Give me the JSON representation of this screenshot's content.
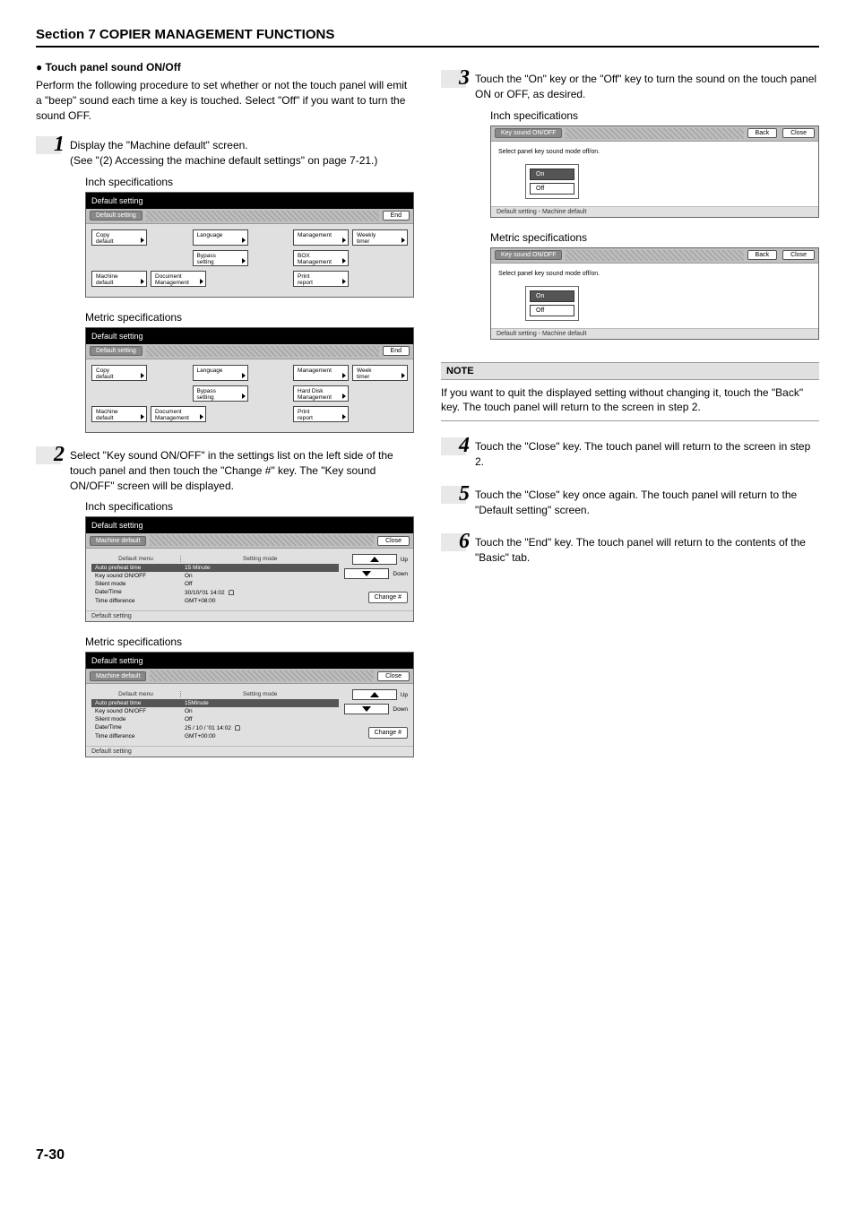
{
  "header": "Section 7  COPIER MANAGEMENT FUNCTIONS",
  "subsection_title": "Touch panel sound ON/Off",
  "intro": "Perform the following procedure to set whether or not the touch panel will emit a \"beep\" sound each time a key is touched. Select \"Off\" if you want to turn the sound OFF.",
  "step1": {
    "num": "1",
    "text": "Display the \"Machine default\" screen.\n(See \"(2) Accessing the machine default settings\" on page 7-21.)"
  },
  "inch_label": "Inch specifications",
  "metric_label": "Metric specifications",
  "panel_ds_inch": {
    "title": "Default setting",
    "crumb": "Default setting",
    "end": "End",
    "tiles_r1": [
      "Copy\ndefault",
      "Language",
      "Management",
      "Weekly\ntimer"
    ],
    "tiles_r1b": [
      "Bypass\nsetting",
      "BOX\nManagement"
    ],
    "tiles_r2": [
      "Machine\ndefault",
      "Document\nManagement",
      "Print\nreport"
    ]
  },
  "panel_ds_metric": {
    "title": "Default setting",
    "crumb": "Default setting",
    "end": "End",
    "tiles_r1": [
      "Copy\ndefault",
      "Language",
      "Management",
      "Week\ntimer"
    ],
    "tiles_r1b": [
      "Bypass\nsetting",
      "Hard Disk\nManagement"
    ],
    "tiles_r2": [
      "Machine\ndefault",
      "Document\nManagement",
      "Print\nreport"
    ]
  },
  "step2": {
    "num": "2",
    "text": "Select \"Key sound ON/OFF\" in the settings list on the left side of the touch panel and then touch the \"Change #\" key. The \"Key sound ON/OFF\" screen will be displayed."
  },
  "panel_md_inch": {
    "title": "Default setting",
    "crumb": "Machine default",
    "close": "Close",
    "head_left": "Default menu",
    "head_right": "Setting mode",
    "rows": [
      {
        "l": "Auto preheat time",
        "r": "15 Minute",
        "sel": true
      },
      {
        "l": "Key sound ON/OFF",
        "r": "On"
      },
      {
        "l": "Silent mode",
        "r": "Off"
      },
      {
        "l": "Date/Time",
        "r": "30/10/'01 14:02"
      },
      {
        "l": "Time difference",
        "r": "GMT+08:00"
      }
    ],
    "up": "Up",
    "down": "Down",
    "change": "Change #",
    "foot": "Default setting"
  },
  "panel_md_metric": {
    "title": "Default setting",
    "crumb": "Machine default",
    "close": "Close",
    "head_left": "Default menu",
    "head_right": "Setting mode",
    "rows": [
      {
        "l": "Auto preheat time",
        "r": "15Minute",
        "sel": true
      },
      {
        "l": "Key sound ON/OFF",
        "r": "On"
      },
      {
        "l": "Silent mode",
        "r": "Off"
      },
      {
        "l": "Date/Time",
        "r": "25 / 10 / '01 14:02"
      },
      {
        "l": "Time difference",
        "r": "GMT+00:00"
      }
    ],
    "up": "Up",
    "down": "Down",
    "change": "Change #",
    "foot": "Default setting"
  },
  "step3": {
    "num": "3",
    "text": "Touch the \"On\" key or the \"Off\" key to turn the sound on the touch panel ON or OFF, as desired."
  },
  "panel_ks": {
    "crumb": "Key sound ON/OFF",
    "back": "Back",
    "close": "Close",
    "instr": "Select panel key sound mode off/on.",
    "on": "On",
    "off": "Off",
    "foot": "Default setting - Machine default"
  },
  "note": {
    "head": "NOTE",
    "body": "If you want to quit the displayed setting without changing it, touch the \"Back\" key. The touch panel will return to the screen in step 2."
  },
  "step4": {
    "num": "4",
    "text": "Touch the \"Close\" key. The touch panel will return to the screen in step 2."
  },
  "step5": {
    "num": "5",
    "text": "Touch the \"Close\" key once again. The touch panel will return to the \"Default setting\" screen."
  },
  "step6": {
    "num": "6",
    "text": "Touch the \"End\" key. The touch panel will return to the contents of the \"Basic\" tab."
  },
  "page_number": "7-30"
}
